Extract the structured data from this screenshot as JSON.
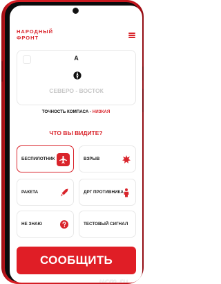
{
  "header": {
    "logo_line1": "НАРОДНЫЙ",
    "logo_line2": "ФРОНТ"
  },
  "compass": {
    "north_letter": "А",
    "direction_label": "СЕВЕРО - ВОСТОК",
    "accuracy_label": "ТОЧНОСТЬ КОМПАСА - ",
    "accuracy_value": "НИЗКАЯ"
  },
  "question": "ЧТО ВЫ ВИДИТЕ?",
  "options": [
    {
      "label": "БЕСПИЛОТНИК",
      "icon": "airplane-icon",
      "selected": true
    },
    {
      "label": "ВЗРЫВ",
      "icon": "explosion-icon",
      "selected": false
    },
    {
      "label": "РАКЕТА",
      "icon": "rocket-icon",
      "selected": false
    },
    {
      "label": "ДРГ ПРОТИВНИКА",
      "icon": "soldier-icon",
      "selected": false
    },
    {
      "label": "НЕ ЗНАЮ",
      "icon": "question-icon",
      "selected": false
    },
    {
      "label": "ТЕСТОВЫЙ СИГНАЛ",
      "icon": "",
      "selected": false
    }
  ],
  "pager": {
    "pages": 2,
    "current": 1
  },
  "report_button": "СООБЩИТЬ",
  "watermark": "ucm.ru",
  "colors": {
    "accent": "#d9242b",
    "phone_body": "#c2151c"
  }
}
